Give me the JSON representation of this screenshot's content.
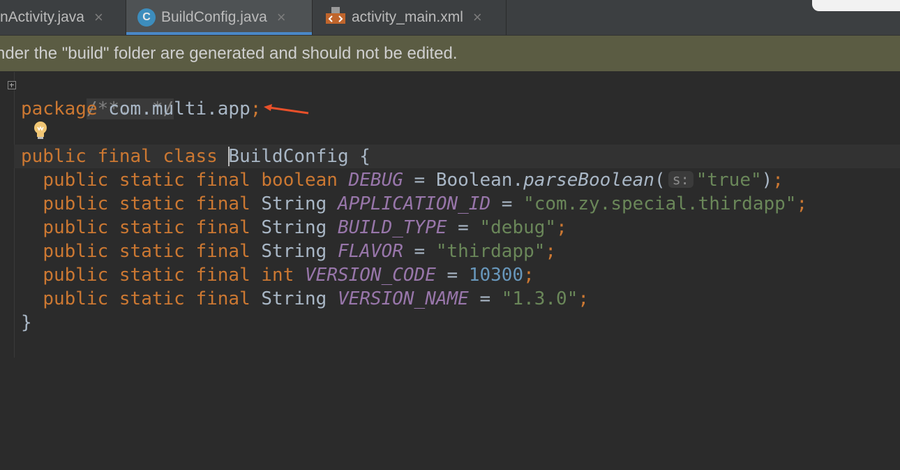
{
  "tabs": [
    {
      "label": "nActivity.java",
      "active": false
    },
    {
      "label": "BuildConfig.java",
      "active": true,
      "icon_letter": "C"
    },
    {
      "label": "activity_main.xml",
      "active": false
    }
  ],
  "close_glyph": "×",
  "banner": {
    "text": "nder the \"build\" folder are generated and should not be edited."
  },
  "code": {
    "comment_fold": "/**...*/",
    "kw_package": "package",
    "package_name": "com.multi.app",
    "semicolon": ";",
    "class_decl_kw": "public final class",
    "class_name_first": "B",
    "class_name_rest": "uildConfig",
    "open_brace": " {",
    "close_brace": "}",
    "modifiers": "public static final",
    "hint_label": "s:",
    "fields": [
      {
        "type": "boolean",
        "type_is_kw": true,
        "name": "DEBUG",
        "value_pre": "Boolean.",
        "method": "parseBoolean",
        "paren_open": "(",
        "value": "\"true\"",
        "paren_close": ")",
        "value_kind": "str",
        "has_hint": true
      },
      {
        "type": "String",
        "type_is_kw": false,
        "name": "APPLICATION_ID",
        "value": "\"com.zy.special.thirdapp\"",
        "value_kind": "str"
      },
      {
        "type": "String",
        "type_is_kw": false,
        "name": "BUILD_TYPE",
        "value": "\"debug\"",
        "value_kind": "str"
      },
      {
        "type": "String",
        "type_is_kw": false,
        "name": "FLAVOR",
        "value": "\"thirdapp\"",
        "value_kind": "str"
      },
      {
        "type": "int",
        "type_is_kw": true,
        "name": "VERSION_CODE",
        "value": "10300",
        "value_kind": "num"
      },
      {
        "type": "String",
        "type_is_kw": false,
        "name": "VERSION_NAME",
        "value": "\"1.3.0\"",
        "value_kind": "str"
      }
    ]
  },
  "colors": {
    "keyword": "#cc7832",
    "string": "#6a8759",
    "number": "#6897bb",
    "field": "#9876aa",
    "text": "#a9b7c6",
    "arrow": "#e8502a"
  }
}
